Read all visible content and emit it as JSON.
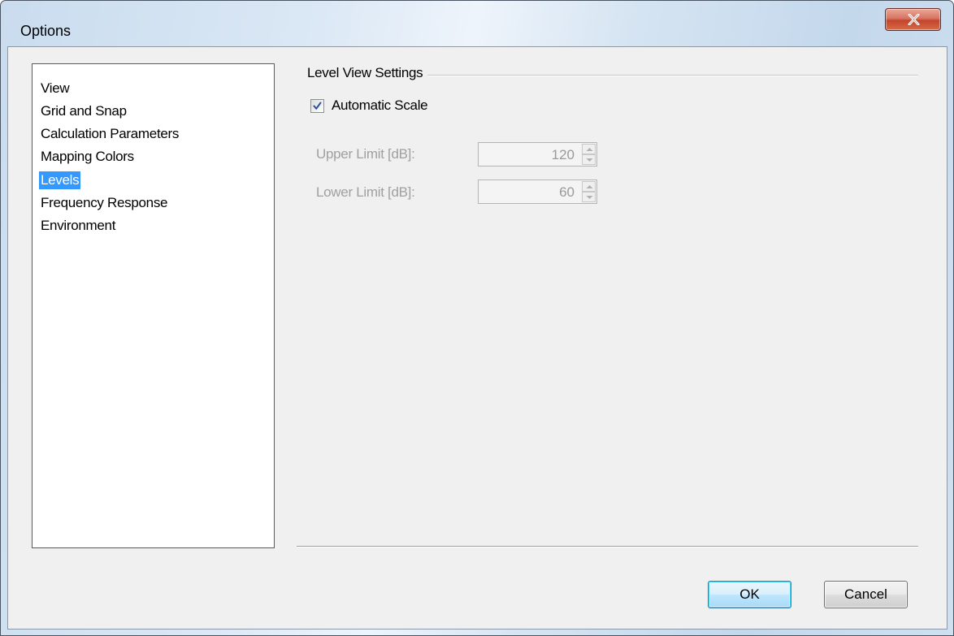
{
  "window": {
    "title": "Options"
  },
  "tree": {
    "items": [
      {
        "label": "View",
        "selected": false
      },
      {
        "label": "Grid and Snap",
        "selected": false
      },
      {
        "label": "Calculation Parameters",
        "selected": false
      },
      {
        "label": "Mapping Colors",
        "selected": false
      },
      {
        "label": "Levels",
        "selected": true
      },
      {
        "label": "Frequency Response",
        "selected": false
      },
      {
        "label": "Environment",
        "selected": false
      }
    ]
  },
  "level_view": {
    "group_title": "Level View Settings",
    "automatic_scale": {
      "label": "Automatic Scale",
      "checked": true
    },
    "upper_limit": {
      "label": "Upper Limit [dB]:",
      "value": "120",
      "enabled": false
    },
    "lower_limit": {
      "label": "Lower Limit [dB]:",
      "value": "60",
      "enabled": false
    }
  },
  "buttons": {
    "ok": "OK",
    "cancel": "Cancel"
  },
  "icons": {
    "close": "close-icon",
    "check": "checkmark-icon",
    "spin_up": "chevron-up-icon",
    "spin_down": "chevron-down-icon"
  },
  "colors": {
    "selection": "#3399ff",
    "close_button": "#c4452b",
    "disabled_text": "#a0a0a0"
  }
}
